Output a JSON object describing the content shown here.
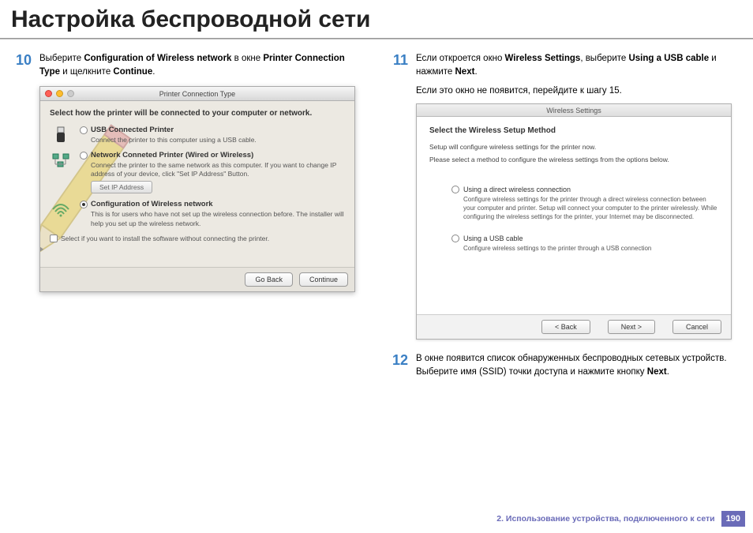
{
  "title": "Настройка беспроводной сети",
  "step10": {
    "num": "10",
    "text_pre": "Выберите ",
    "bold1": "Configuration of Wireless network",
    "text_mid": " в окне ",
    "bold2": "Printer Connection Type",
    "text_mid2": " и щелкните ",
    "bold3": "Continue",
    "text_end": "."
  },
  "dialog1": {
    "title": "Printer Connection Type",
    "heading": "Select how the printer will be connected to your computer or network.",
    "opt1_label": "USB Connected Printer",
    "opt1_desc": "Connect the printer to this computer using a USB cable.",
    "opt2_label": "Network Conneted Printer (Wired or Wireless)",
    "opt2_desc": "Connect the printer to the same network as this computer. If you want to change IP address of your device, click \"Set IP Address\" Button.",
    "setip": "Set IP Address",
    "opt3_label": "Configuration of Wireless network",
    "opt3_desc": "This is for users who have not set up the wireless connection before. The installer will help you set up the wireless network.",
    "checkbox": "Select if you want to install the software without connecting the printer.",
    "btn_back": "Go Back",
    "btn_continue": "Continue"
  },
  "step11": {
    "num": "11",
    "text_pre": "Если откроется окно ",
    "bold1": "Wireless Settings",
    "text_mid": ", выберите ",
    "bold2": "Using a USB cable",
    "text_mid2": " и нажмите ",
    "bold3": "Next",
    "text_end": ".",
    "sub": "Если это окно не появится, перейдите к шагу 15."
  },
  "dialog2": {
    "title": "Wireless Settings",
    "heading": "Select the Wireless Setup Method",
    "sub1": "Setup will configure wireless settings for the printer now.",
    "sub2": "Please select a method to configure the wireless settings from the options below.",
    "opt1_label": "Using a direct wireless connection",
    "opt1_desc": "Configure wireless settings for the printer through a direct wireless connection between your computer and printer. Setup will connect your computer to the printer wirelessly. While configuring the wireless settings for the printer, your Internet may be disconnected.",
    "opt2_label": "Using a USB cable",
    "opt2_desc": "Configure wireless settings to the printer through a USB connection",
    "btn_back": "< Back",
    "btn_next": "Next >",
    "btn_cancel": "Cancel"
  },
  "step12": {
    "num": "12",
    "text_pre": "В окне появится список обнаруженных беспроводных сетевых устройств. Выберите имя (SSID) точки доступа и нажмите кнопку ",
    "bold1": "Next",
    "text_end": "."
  },
  "footer": {
    "chapter": "2.  Использование устройства, подключенного к сети",
    "page": "190"
  }
}
